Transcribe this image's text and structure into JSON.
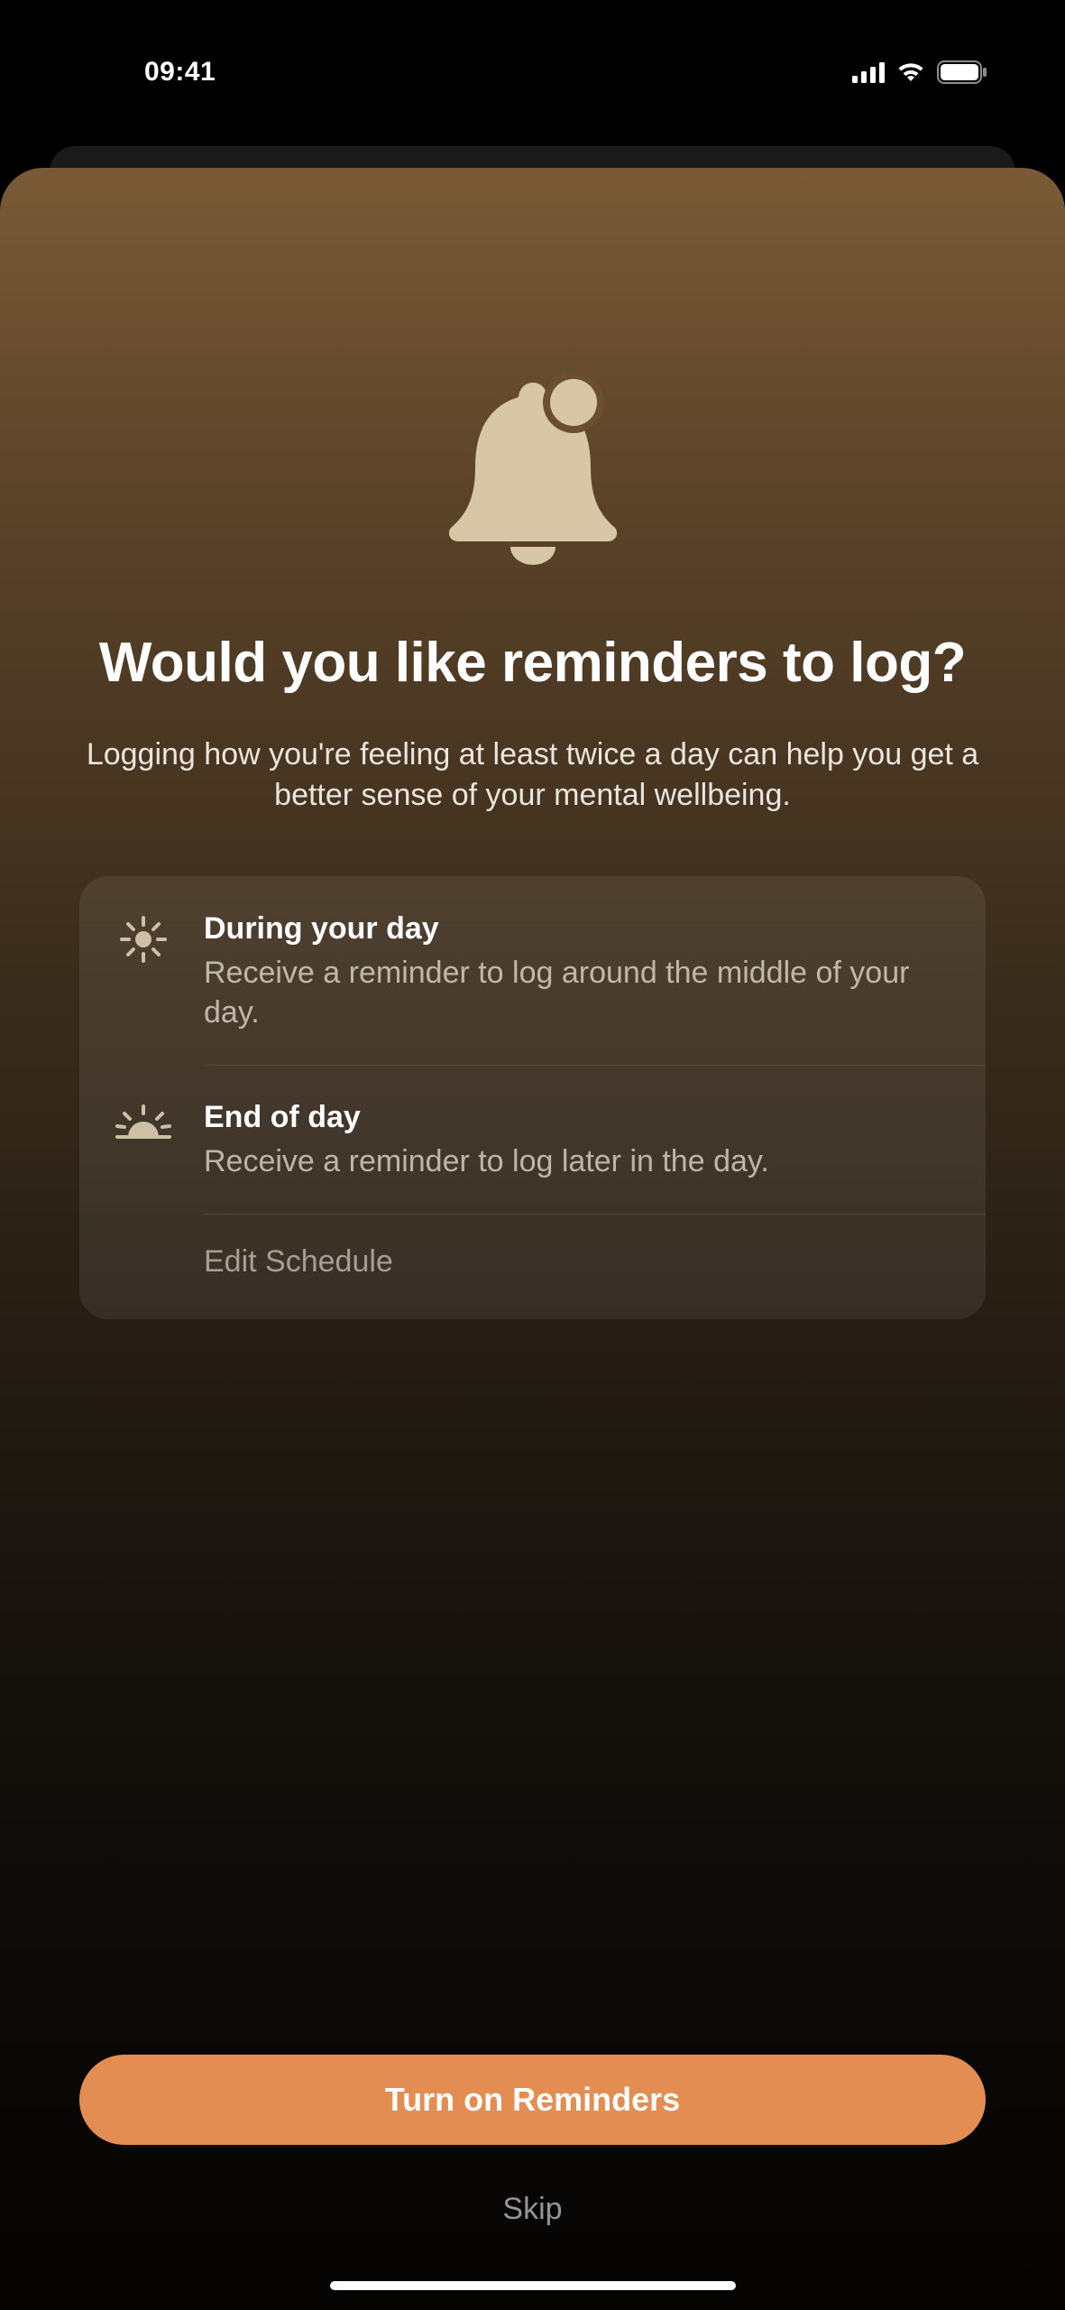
{
  "status": {
    "time": "09:41"
  },
  "sheet": {
    "title": "Would you like reminders to log?",
    "subtitle": "Logging how you're feeling at least twice a day can help you get a better sense of your mental wellbeing.",
    "items": [
      {
        "icon": "sun-icon",
        "title": "During your day",
        "desc": "Receive a reminder to log around the middle of your day."
      },
      {
        "icon": "sunset-icon",
        "title": "End of day",
        "desc": "Receive a reminder to log later in the day."
      }
    ],
    "edit_label": "Edit Schedule",
    "primary_button": "Turn on Reminders",
    "secondary_button": "Skip"
  },
  "colors": {
    "accent": "#e48d53",
    "icon": "#d8c7a7"
  }
}
